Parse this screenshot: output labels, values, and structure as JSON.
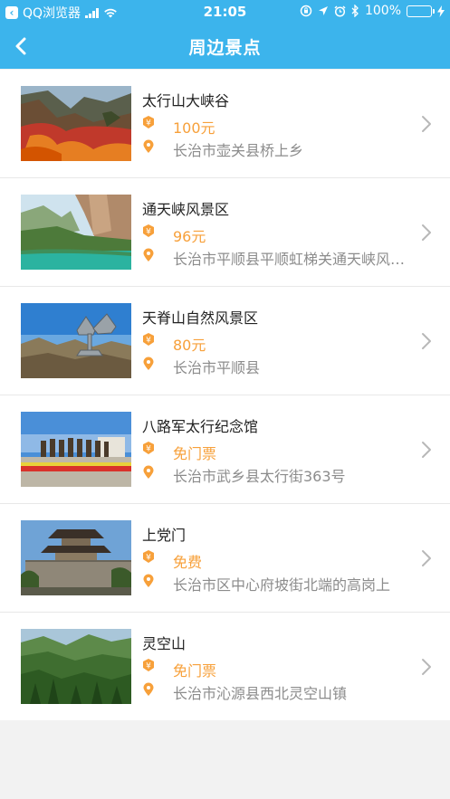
{
  "status_bar": {
    "back_app_label": "QQ浏览器",
    "time": "21:05",
    "battery_percent": "100%",
    "colors": {
      "bar": "#3cb4ec",
      "battery": "#4cd964"
    }
  },
  "nav": {
    "title": "周边景点",
    "back_icon": "chevron-left-icon"
  },
  "theme": {
    "accent": "#3cb4ec",
    "price": "#f7a03a",
    "icon_orange": "#f7a03a"
  },
  "attractions": [
    {
      "name": "太行山大峡谷",
      "price": "100元",
      "address": "长治市壶关县桥上乡"
    },
    {
      "name": "通天峡风景区",
      "price": "96元",
      "address": "长治市平顺县平顺虹梯关通天峡风景区"
    },
    {
      "name": "天脊山自然风景区",
      "price": "80元",
      "address": "长治市平顺县"
    },
    {
      "name": "八路军太行纪念馆",
      "price": "免门票",
      "address": "长治市武乡县太行街363号"
    },
    {
      "name": "上党门",
      "price": "免费",
      "address": "长治市区中心府坡街北端的高岗上"
    },
    {
      "name": "灵空山",
      "price": "免门票",
      "address": "长治市沁源县西北灵空山镇"
    }
  ]
}
